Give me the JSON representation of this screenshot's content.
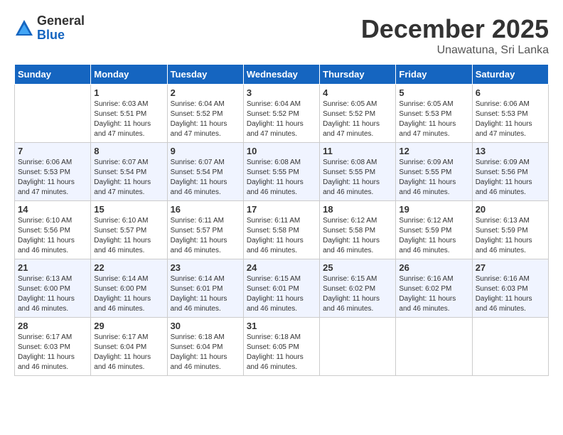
{
  "header": {
    "logo_general": "General",
    "logo_blue": "Blue",
    "month_title": "December 2025",
    "location": "Unawatuna, Sri Lanka"
  },
  "weekdays": [
    "Sunday",
    "Monday",
    "Tuesday",
    "Wednesday",
    "Thursday",
    "Friday",
    "Saturday"
  ],
  "weeks": [
    [
      {
        "day": "",
        "sunrise": "",
        "sunset": "",
        "daylight": ""
      },
      {
        "day": "1",
        "sunrise": "Sunrise: 6:03 AM",
        "sunset": "Sunset: 5:51 PM",
        "daylight": "Daylight: 11 hours and 47 minutes."
      },
      {
        "day": "2",
        "sunrise": "Sunrise: 6:04 AM",
        "sunset": "Sunset: 5:52 PM",
        "daylight": "Daylight: 11 hours and 47 minutes."
      },
      {
        "day": "3",
        "sunrise": "Sunrise: 6:04 AM",
        "sunset": "Sunset: 5:52 PM",
        "daylight": "Daylight: 11 hours and 47 minutes."
      },
      {
        "day": "4",
        "sunrise": "Sunrise: 6:05 AM",
        "sunset": "Sunset: 5:52 PM",
        "daylight": "Daylight: 11 hours and 47 minutes."
      },
      {
        "day": "5",
        "sunrise": "Sunrise: 6:05 AM",
        "sunset": "Sunset: 5:53 PM",
        "daylight": "Daylight: 11 hours and 47 minutes."
      },
      {
        "day": "6",
        "sunrise": "Sunrise: 6:06 AM",
        "sunset": "Sunset: 5:53 PM",
        "daylight": "Daylight: 11 hours and 47 minutes."
      }
    ],
    [
      {
        "day": "7",
        "sunrise": "Sunrise: 6:06 AM",
        "sunset": "Sunset: 5:53 PM",
        "daylight": "Daylight: 11 hours and 47 minutes."
      },
      {
        "day": "8",
        "sunrise": "Sunrise: 6:07 AM",
        "sunset": "Sunset: 5:54 PM",
        "daylight": "Daylight: 11 hours and 47 minutes."
      },
      {
        "day": "9",
        "sunrise": "Sunrise: 6:07 AM",
        "sunset": "Sunset: 5:54 PM",
        "daylight": "Daylight: 11 hours and 46 minutes."
      },
      {
        "day": "10",
        "sunrise": "Sunrise: 6:08 AM",
        "sunset": "Sunset: 5:55 PM",
        "daylight": "Daylight: 11 hours and 46 minutes."
      },
      {
        "day": "11",
        "sunrise": "Sunrise: 6:08 AM",
        "sunset": "Sunset: 5:55 PM",
        "daylight": "Daylight: 11 hours and 46 minutes."
      },
      {
        "day": "12",
        "sunrise": "Sunrise: 6:09 AM",
        "sunset": "Sunset: 5:55 PM",
        "daylight": "Daylight: 11 hours and 46 minutes."
      },
      {
        "day": "13",
        "sunrise": "Sunrise: 6:09 AM",
        "sunset": "Sunset: 5:56 PM",
        "daylight": "Daylight: 11 hours and 46 minutes."
      }
    ],
    [
      {
        "day": "14",
        "sunrise": "Sunrise: 6:10 AM",
        "sunset": "Sunset: 5:56 PM",
        "daylight": "Daylight: 11 hours and 46 minutes."
      },
      {
        "day": "15",
        "sunrise": "Sunrise: 6:10 AM",
        "sunset": "Sunset: 5:57 PM",
        "daylight": "Daylight: 11 hours and 46 minutes."
      },
      {
        "day": "16",
        "sunrise": "Sunrise: 6:11 AM",
        "sunset": "Sunset: 5:57 PM",
        "daylight": "Daylight: 11 hours and 46 minutes."
      },
      {
        "day": "17",
        "sunrise": "Sunrise: 6:11 AM",
        "sunset": "Sunset: 5:58 PM",
        "daylight": "Daylight: 11 hours and 46 minutes."
      },
      {
        "day": "18",
        "sunrise": "Sunrise: 6:12 AM",
        "sunset": "Sunset: 5:58 PM",
        "daylight": "Daylight: 11 hours and 46 minutes."
      },
      {
        "day": "19",
        "sunrise": "Sunrise: 6:12 AM",
        "sunset": "Sunset: 5:59 PM",
        "daylight": "Daylight: 11 hours and 46 minutes."
      },
      {
        "day": "20",
        "sunrise": "Sunrise: 6:13 AM",
        "sunset": "Sunset: 5:59 PM",
        "daylight": "Daylight: 11 hours and 46 minutes."
      }
    ],
    [
      {
        "day": "21",
        "sunrise": "Sunrise: 6:13 AM",
        "sunset": "Sunset: 6:00 PM",
        "daylight": "Daylight: 11 hours and 46 minutes."
      },
      {
        "day": "22",
        "sunrise": "Sunrise: 6:14 AM",
        "sunset": "Sunset: 6:00 PM",
        "daylight": "Daylight: 11 hours and 46 minutes."
      },
      {
        "day": "23",
        "sunrise": "Sunrise: 6:14 AM",
        "sunset": "Sunset: 6:01 PM",
        "daylight": "Daylight: 11 hours and 46 minutes."
      },
      {
        "day": "24",
        "sunrise": "Sunrise: 6:15 AM",
        "sunset": "Sunset: 6:01 PM",
        "daylight": "Daylight: 11 hours and 46 minutes."
      },
      {
        "day": "25",
        "sunrise": "Sunrise: 6:15 AM",
        "sunset": "Sunset: 6:02 PM",
        "daylight": "Daylight: 11 hours and 46 minutes."
      },
      {
        "day": "26",
        "sunrise": "Sunrise: 6:16 AM",
        "sunset": "Sunset: 6:02 PM",
        "daylight": "Daylight: 11 hours and 46 minutes."
      },
      {
        "day": "27",
        "sunrise": "Sunrise: 6:16 AM",
        "sunset": "Sunset: 6:03 PM",
        "daylight": "Daylight: 11 hours and 46 minutes."
      }
    ],
    [
      {
        "day": "28",
        "sunrise": "Sunrise: 6:17 AM",
        "sunset": "Sunset: 6:03 PM",
        "daylight": "Daylight: 11 hours and 46 minutes."
      },
      {
        "day": "29",
        "sunrise": "Sunrise: 6:17 AM",
        "sunset": "Sunset: 6:04 PM",
        "daylight": "Daylight: 11 hours and 46 minutes."
      },
      {
        "day": "30",
        "sunrise": "Sunrise: 6:18 AM",
        "sunset": "Sunset: 6:04 PM",
        "daylight": "Daylight: 11 hours and 46 minutes."
      },
      {
        "day": "31",
        "sunrise": "Sunrise: 6:18 AM",
        "sunset": "Sunset: 6:05 PM",
        "daylight": "Daylight: 11 hours and 46 minutes."
      },
      {
        "day": "",
        "sunrise": "",
        "sunset": "",
        "daylight": ""
      },
      {
        "day": "",
        "sunrise": "",
        "sunset": "",
        "daylight": ""
      },
      {
        "day": "",
        "sunrise": "",
        "sunset": "",
        "daylight": ""
      }
    ]
  ]
}
